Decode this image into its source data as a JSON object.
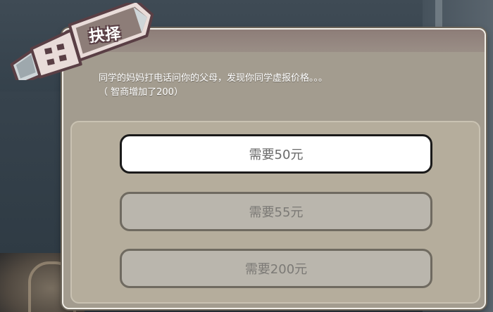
{
  "header": {
    "title": "抉择",
    "icon": "usb-plug-icon"
  },
  "message": {
    "line1": "同学的妈妈打电话问你的父母，发现你同学虚报价格。。。",
    "line2": "（ 智商增加了200）"
  },
  "choices": [
    {
      "label": "需要50元",
      "state": "selected"
    },
    {
      "label": "需要55元",
      "state": "normal"
    },
    {
      "label": "需要200元",
      "state": "normal"
    }
  ],
  "colors": {
    "dialog_bg": "#a39c8f",
    "panel_bg": "#b5ad9c",
    "selected_bg": "#ffffff",
    "normal_bg": "#bab6ad",
    "badge_body": "#e9dcd9",
    "badge_outline": "#5a3f45"
  }
}
